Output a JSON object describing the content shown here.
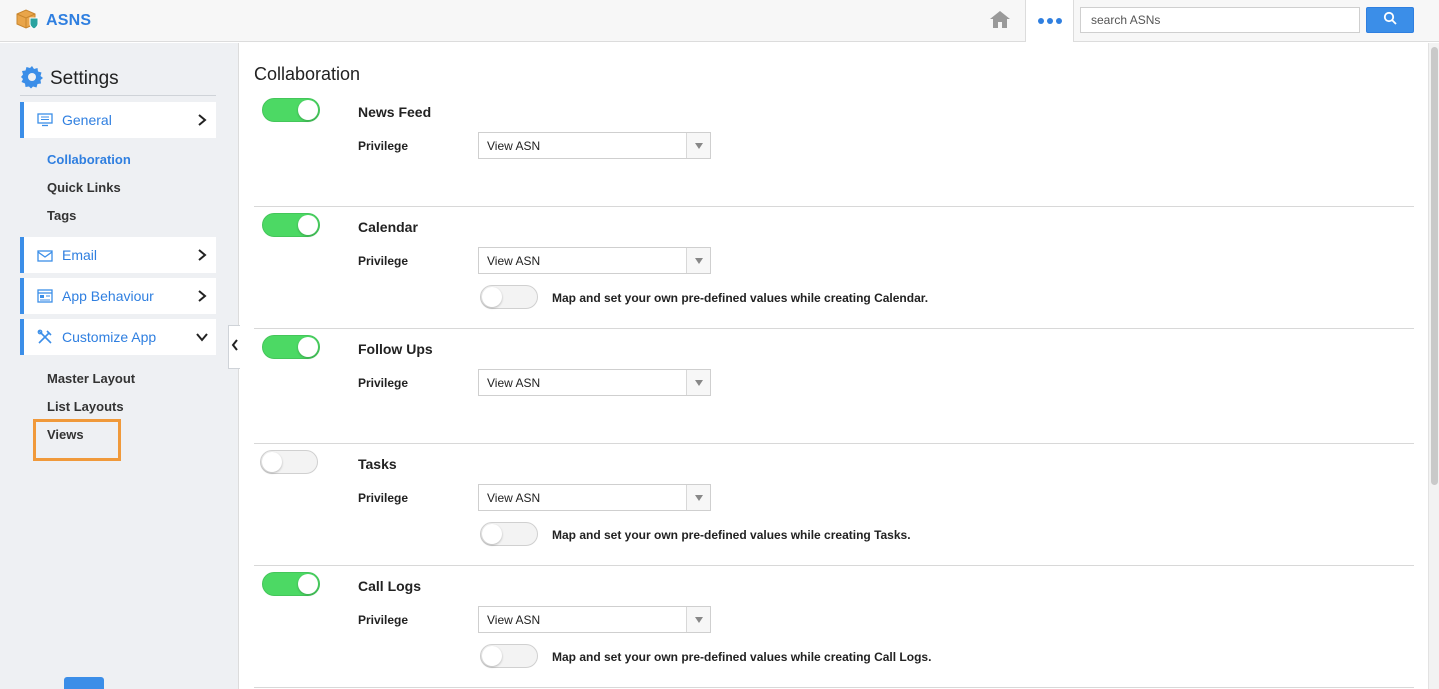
{
  "app": {
    "name": "ASNS",
    "search_placeholder": "search ASNs",
    "colors": {
      "accent": "#2f7fe0",
      "toggle_on": "#4cd964",
      "highlight": "#f0993a"
    }
  },
  "sidebar": {
    "title": "Settings",
    "groups": [
      {
        "label": "General",
        "icon": "monitor-icon",
        "expanded": false
      },
      {
        "label": "Email",
        "icon": "envelope-icon",
        "expanded": false
      },
      {
        "label": "App Behaviour",
        "icon": "window-icon",
        "expanded": false
      },
      {
        "label": "Customize App",
        "icon": "tools-icon",
        "expanded": true
      }
    ],
    "general_items": [
      "Collaboration",
      "Quick Links",
      "Tags"
    ],
    "customize_items": [
      "Master Layout",
      "List Layouts",
      "Views"
    ],
    "active_item": "Collaboration"
  },
  "main": {
    "title": "Collaboration",
    "sections": [
      {
        "name": "News Feed",
        "enabled": true,
        "privilege_label": "Privilege",
        "privilege": "View ASN",
        "map_text": ""
      },
      {
        "name": "Calendar",
        "enabled": true,
        "privilege_label": "Privilege",
        "privilege": "View ASN",
        "map_text": "Map and set your own pre-defined values while creating Calendar."
      },
      {
        "name": "Follow Ups",
        "enabled": true,
        "privilege_label": "Privilege",
        "privilege": "View ASN",
        "map_text": ""
      },
      {
        "name": "Tasks",
        "enabled": false,
        "privilege_label": "Privilege",
        "privilege": "View ASN",
        "map_text": "Map and set your own pre-defined values while creating Tasks."
      },
      {
        "name": "Call Logs",
        "enabled": true,
        "privilege_label": "Privilege",
        "privilege": "View ASN",
        "map_text": "Map and set your own pre-defined values while creating Call Logs."
      }
    ]
  }
}
